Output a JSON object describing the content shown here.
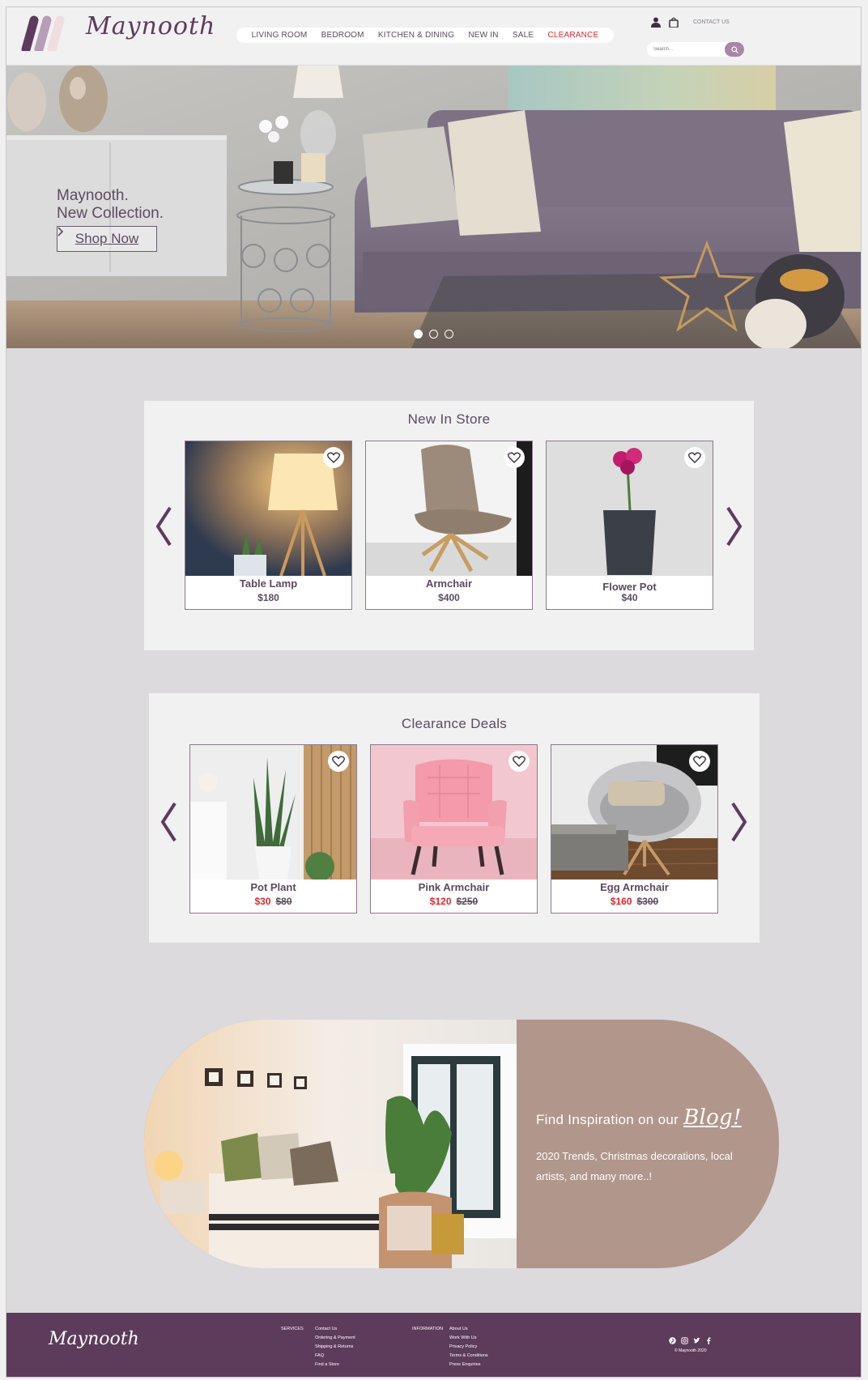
{
  "brand": {
    "name": "Maynooth"
  },
  "nav": {
    "items": [
      {
        "label": "LIVING ROOM"
      },
      {
        "label": "BEDROOM"
      },
      {
        "label": "KITCHEN & DINING"
      },
      {
        "label": "NEW IN"
      },
      {
        "label": "SALE"
      },
      {
        "label": "CLEARANCE"
      }
    ]
  },
  "header": {
    "contact_label": "CONTACT US",
    "search_placeholder": "Search..."
  },
  "hero": {
    "line1": "Maynooth.",
    "line2": "New Collection.",
    "cta": "Shop Now",
    "slides": 3,
    "active_slide": 1
  },
  "new_in": {
    "title": "New In Store",
    "items": [
      {
        "name": "Table Lamp",
        "price": "$180"
      },
      {
        "name": "Armchair",
        "price": "$400"
      },
      {
        "name": "Flower Pot",
        "price": "$40"
      }
    ]
  },
  "clearance": {
    "title": "Clearance Deals",
    "items": [
      {
        "name": "Pot Plant",
        "sale": "$30",
        "old": "$80"
      },
      {
        "name": "Pink Armchair",
        "sale": "$120",
        "old": "$250"
      },
      {
        "name": "Egg Armchair",
        "sale": "$160",
        "old": "$300"
      }
    ]
  },
  "blog": {
    "title": "Find Inspiration on our",
    "script": "Blog!",
    "text": "2020 Trends, Christmas decorations, local artists, and many more..!"
  },
  "footer": {
    "services_heading": "SERVICES",
    "services": [
      "Contact Us",
      "Ordering & Payment",
      "Shipping & Returns",
      "FAQ",
      "Find a Store"
    ],
    "info_heading": "INFORMATION",
    "info": [
      "About Us",
      "Work With Us",
      "Privacy Policy",
      "Terms & Conditions",
      "Press Enquiries"
    ],
    "copyright": "© Maynooth 2020"
  },
  "colors": {
    "brand_purple": "#5c3b5b",
    "accent_red": "#e0262d",
    "blog_tan": "#b1968b"
  },
  "icons": [
    "user-icon",
    "shopping-bag-icon",
    "search-icon",
    "heart-icon",
    "chevron-left-icon",
    "chevron-right-icon",
    "pinterest-icon",
    "instagram-icon",
    "twitter-icon",
    "facebook-icon"
  ]
}
